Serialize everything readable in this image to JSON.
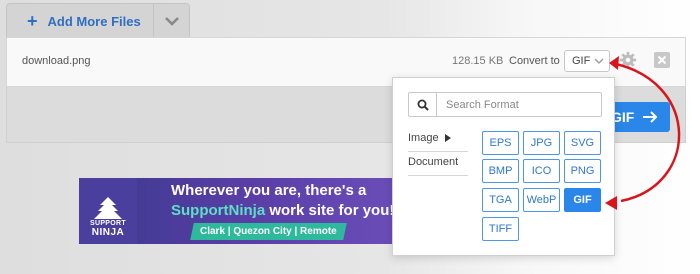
{
  "toolbar": {
    "add_more_label": "Add More Files",
    "add_icon": "plus-icon",
    "toggle_icon": "chevron-down-icon"
  },
  "file_row": {
    "file_name": "download.png",
    "file_size": "128.15 KB",
    "convert_to_label": "Convert to",
    "selected_format": "GIF",
    "settings_icon": "gear-icon",
    "remove_icon": "close-icon"
  },
  "action": {
    "convert_button_label": "GIF",
    "arrow_icon": "arrow-right-icon"
  },
  "banner": {
    "logo_line1": "SUPPORT",
    "logo_line2": "NINJA",
    "line1": "Wherever you are, there's a",
    "line2_brand": "SupportNinja",
    "line2_rest": " work site for you!",
    "tagline": "Clark | Quezon City | Remote"
  },
  "popup": {
    "search_placeholder": "Search Format",
    "search_icon": "search-icon",
    "categories": [
      {
        "label": "Image"
      },
      {
        "label": "Document"
      }
    ],
    "formats": [
      "EPS",
      "JPG",
      "SVG",
      "BMP",
      "ICO",
      "PNG",
      "TGA",
      "WebP",
      "GIF",
      "TIFF"
    ],
    "selected": "GIF"
  },
  "colors": {
    "accent": "#2a86e8",
    "annotation_arrow": "#d9151b",
    "link_blue": "#2f6fc3"
  }
}
